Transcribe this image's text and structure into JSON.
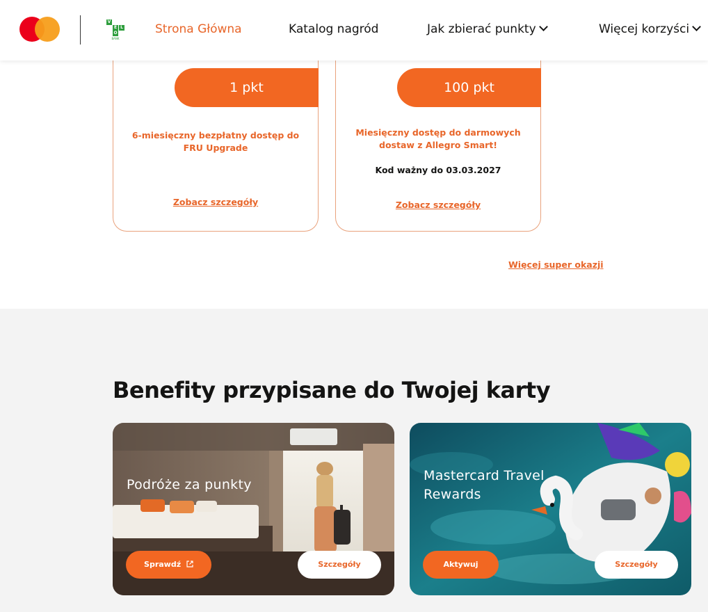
{
  "header": {
    "nav": [
      {
        "label": "Strona Główna"
      },
      {
        "label": "Katalog nagród"
      },
      {
        "label": "Jak zbierać punkty"
      },
      {
        "label": "Więcej korzyści"
      }
    ],
    "velo_letters": [
      "V",
      "E",
      "L",
      "O"
    ],
    "velo_bank": "BANK"
  },
  "offers": [
    {
      "points": "1 pkt",
      "title": "6-miesięczny bezpłatny dostęp do FRU Upgrade",
      "code": "",
      "link": "Zobacz szczegóły"
    },
    {
      "points": "100 pkt",
      "title": "Miesięczny dostęp do darmowych dostaw z Allegro Smart!",
      "code": "Kod ważny do 03.03.2027",
      "link": "Zobacz szczegóły"
    }
  ],
  "more_link": "Więcej super okazji",
  "benefits": {
    "title": "Benefity przypisane do Twojej karty",
    "cards": [
      {
        "title": "Podróże za punkty",
        "primary_button": "Sprawdź",
        "secondary_button": "Szczegóły"
      },
      {
        "title": "Mastercard Travel Rewards",
        "primary_button": "Aktywuj",
        "secondary_button": "Szczegóły"
      }
    ]
  },
  "colors": {
    "accent": "#f26722",
    "accent_text": "#e8662a",
    "section_bg": "#f3f3f3",
    "velo_green": "#2e9e3d"
  }
}
